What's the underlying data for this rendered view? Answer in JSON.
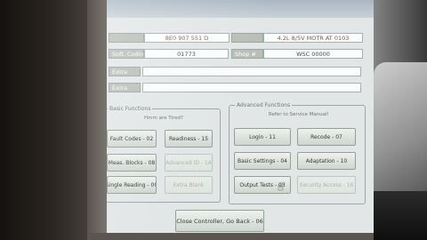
{
  "header": {
    "field1_label": "",
    "field1_value": "8E0 907 551 D",
    "field2_label": "",
    "field2_value": "4.2L 8/5V MOTR AT 0103"
  },
  "info": {
    "soft_coding_label": "Soft. Coding",
    "soft_coding_value": "01773",
    "shop_label": "Shop #",
    "shop_value": "WSC 00000",
    "extra1_label": "Extra",
    "extra1_value": "",
    "extra2_label": "Extra",
    "extra2_value": ""
  },
  "basic_functions": {
    "title": "Basic Functions",
    "subtitle": "Hmm are Tired?",
    "buttons": {
      "fault_codes": "Fault Codes - 02",
      "readiness": "Readiness - 15",
      "meas_blocks": "Meas. Blocks - 08",
      "advanced_id": "Advanced ID - 1A",
      "single_reading": "Single Reading - 09",
      "extra_blank": "Extra Blank"
    }
  },
  "advanced_functions": {
    "title": "Advanced Functions",
    "subtitle": "Refer to Service Manual!",
    "buttons": {
      "login": "Login - 11",
      "recode": "Recode - 07",
      "basic_settings": "Basic Settings - 04",
      "adaptation": "Adaptation - 10",
      "output_tests": "Output Tests - 03",
      "security_access": "Security Access - 16"
    }
  },
  "footer": {
    "close_button": "Close Controller, Go Back - 06"
  },
  "cursor": {
    "icon": "hand-pointer-icon",
    "glyph": "☝"
  }
}
